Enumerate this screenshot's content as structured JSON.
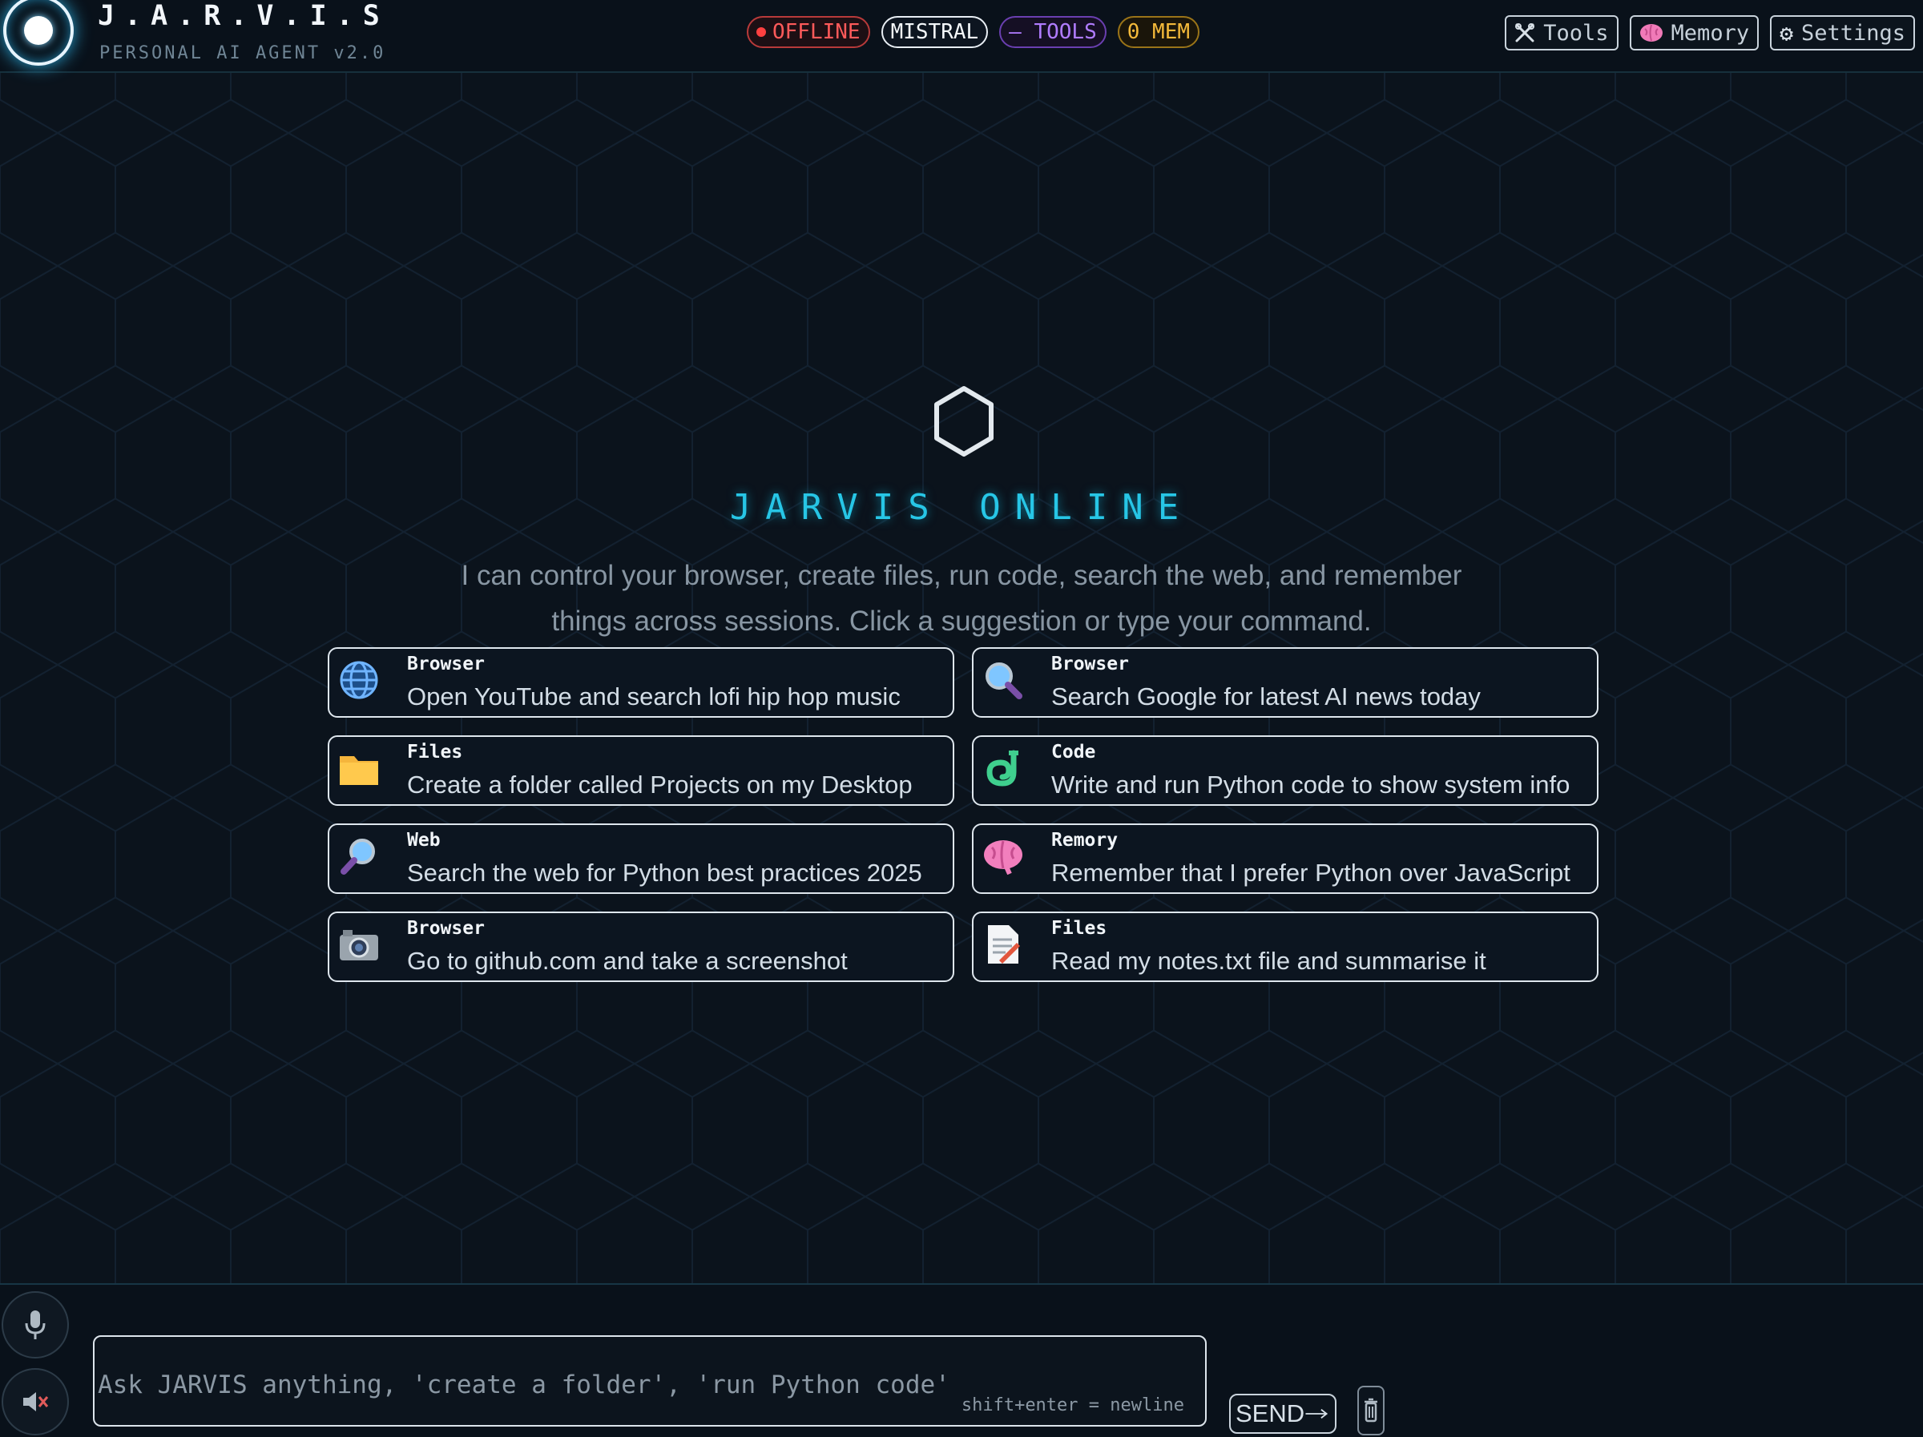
{
  "header": {
    "title": "J.A.R.V.I.S",
    "subtitle": "PERSONAL AI AGENT v2.0",
    "badges": {
      "status": "OFFLINE",
      "model": "MISTRAL",
      "tools": "– TOOLS",
      "memory": "0 MEM"
    },
    "nav": {
      "tools": "Tools",
      "memory": "Memory",
      "settings": "Settings"
    }
  },
  "hero": {
    "title": "JARVIS ONLINE",
    "description": "I can control your browser, create files, run code, search the web, and remember things across sessions. Click a suggestion or type your command."
  },
  "suggestions": [
    {
      "icon": "globe-icon",
      "category": "Browser",
      "text": "Open YouTube and search lofi hip hop music"
    },
    {
      "icon": "magnifier-icon",
      "category": "Browser",
      "text": "Search Google for latest AI news today"
    },
    {
      "icon": "folder-icon",
      "category": "Files",
      "text": "Create a folder called Projects on my Desktop"
    },
    {
      "icon": "code-icon",
      "category": "Code",
      "text": "Write and run Python code to show system info"
    },
    {
      "icon": "magnifier-icon",
      "category": "Web",
      "text": "Search the web for Python best practices 2025"
    },
    {
      "icon": "brain-icon",
      "category": "Remory",
      "text": "Remember that I prefer Python over JavaScript"
    },
    {
      "icon": "camera-icon",
      "category": "Browser",
      "text": "Go to github.com and take a screenshot"
    },
    {
      "icon": "memo-icon",
      "category": "Files",
      "text": "Read my notes.txt file and summarise it"
    }
  ],
  "input": {
    "placeholder": "Ask JARVIS anything, 'create a folder', 'run Python code'",
    "value": "",
    "hint": "shift+enter = newline",
    "send_label": "SEND"
  },
  "colors": {
    "accent": "#27c6e6",
    "offline": "#ff5a5a",
    "tools": "#b07cff",
    "memory": "#f3b93a",
    "background": "#0b131c"
  }
}
